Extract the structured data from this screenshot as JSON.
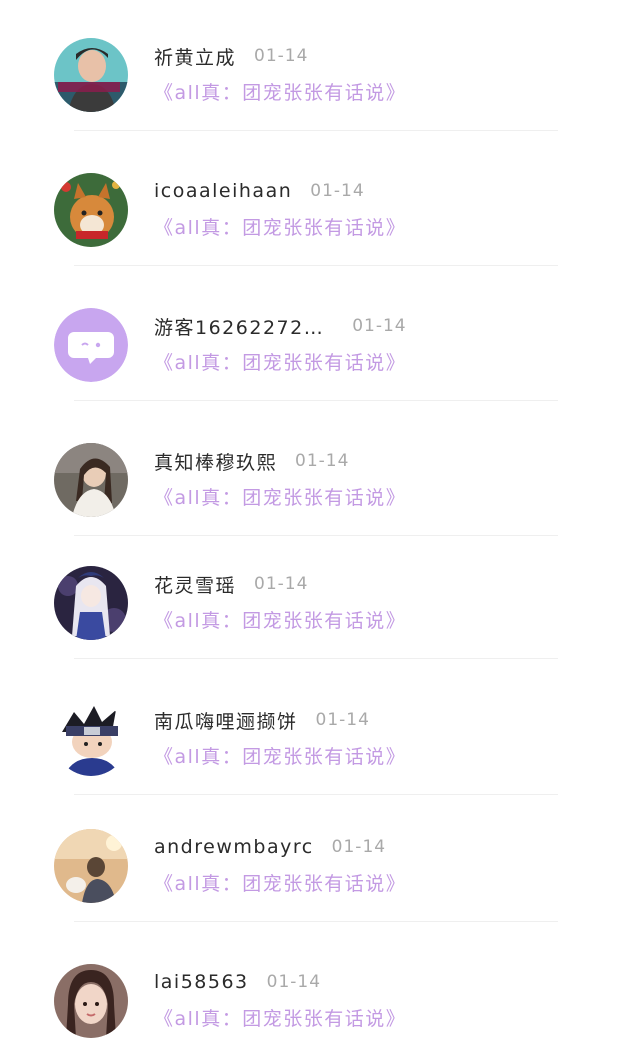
{
  "comments": [
    {
      "name": "祈黄立成",
      "date": "01-14",
      "subtitle": "《all真：团宠张张有话说》",
      "avatar": "photo-boy"
    },
    {
      "name": "icoaaleihaan",
      "date": "01-14",
      "subtitle": "《all真：团宠张张有话说》",
      "avatar": "shiba-dog"
    },
    {
      "name": "游客16262272…",
      "date": "01-14",
      "subtitle": "《all真：团宠张张有话说》",
      "avatar": "default-chat"
    },
    {
      "name": "真知棒穆玖熙",
      "date": "01-14",
      "subtitle": "《all真：团宠张张有话说》",
      "avatar": "photo-girl"
    },
    {
      "name": "花灵雪瑶",
      "date": "01-14",
      "subtitle": "《all真：团宠张张有话说》",
      "avatar": "anime-girl"
    },
    {
      "name": "南瓜嗨哩逦撷饼",
      "date": "01-14",
      "subtitle": "《all真：团宠张张有话说》",
      "avatar": "anime-ninja"
    },
    {
      "name": "andrewmbayrc",
      "date": "01-14",
      "subtitle": "《all真：团宠张张有话说》",
      "avatar": "photo-couple"
    },
    {
      "name": "lai58563",
      "date": "01-14",
      "subtitle": "《all真：团宠张张有话说》",
      "avatar": "photo-portrait"
    }
  ],
  "colors": {
    "accent": "#c39ae3",
    "name": "#2b2b2b",
    "date": "#a9a9a9",
    "divider": "#efefef",
    "default_avatar": "#c8a6ef"
  }
}
